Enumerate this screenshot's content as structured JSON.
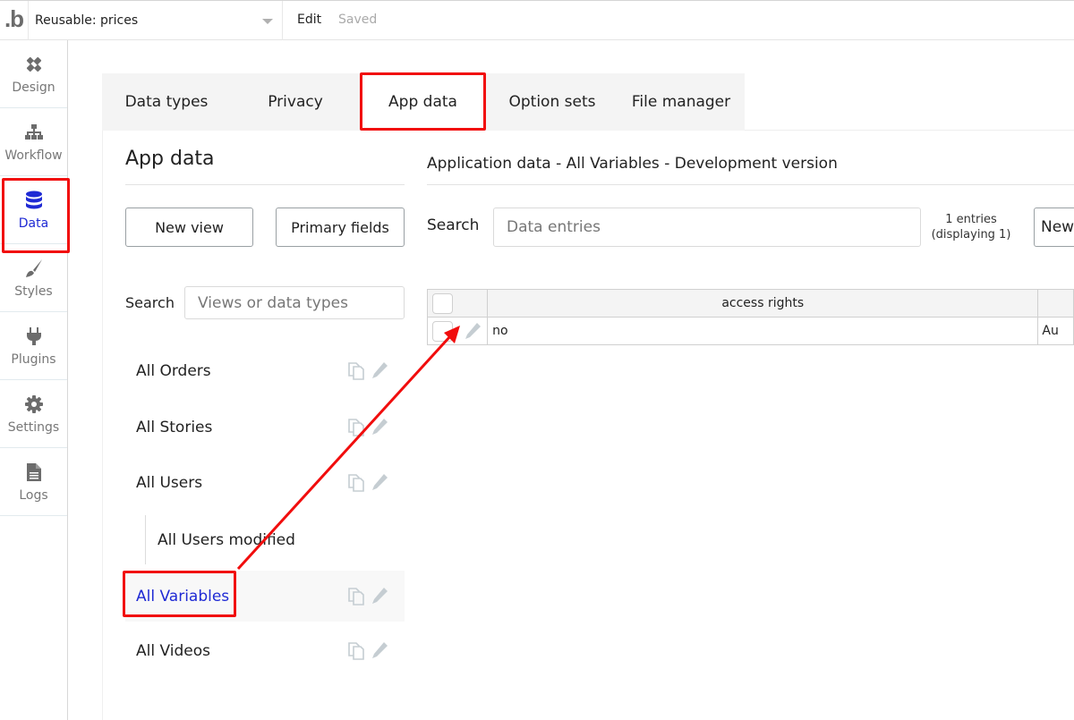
{
  "topbar": {
    "logo_text": ".b",
    "page_name": "Reusable: prices",
    "edit_label": "Edit",
    "status": "Saved"
  },
  "leftnav": {
    "items": [
      {
        "label": "Design",
        "icon": "design-icon"
      },
      {
        "label": "Workflow",
        "icon": "workflow-icon"
      },
      {
        "label": "Data",
        "icon": "database-icon",
        "active": true
      },
      {
        "label": "Styles",
        "icon": "brush-icon"
      },
      {
        "label": "Plugins",
        "icon": "plug-icon"
      },
      {
        "label": "Settings",
        "icon": "gear-icon"
      },
      {
        "label": "Logs",
        "icon": "document-icon"
      }
    ]
  },
  "tabs": [
    {
      "label": "Data types"
    },
    {
      "label": "Privacy"
    },
    {
      "label": "App data",
      "active": true
    },
    {
      "label": "Option sets"
    },
    {
      "label": "File manager"
    }
  ],
  "views_panel": {
    "title": "App data",
    "new_view_label": "New view",
    "primary_fields_label": "Primary fields",
    "search_label": "Search",
    "search_placeholder": "Views or data types",
    "items": [
      {
        "label": "All Orders"
      },
      {
        "label": "All Stories"
      },
      {
        "label": "All Users"
      },
      {
        "label": "All Users modified",
        "child": true
      },
      {
        "label": "All Variables",
        "selected": true
      },
      {
        "label": "All Videos"
      }
    ]
  },
  "data_panel": {
    "title": "Application data - All Variables - Development version",
    "search_label": "Search",
    "search_placeholder": "Data entries",
    "entries_line1": "1 entries",
    "entries_line2": "(displaying 1)",
    "new_entry_label": "New",
    "table": {
      "columns": [
        "access rights",
        ""
      ],
      "rows": [
        [
          "no",
          "Au"
        ]
      ]
    }
  },
  "colors": {
    "accent": "#1f2ad4",
    "highlight": "#f10d0d"
  }
}
